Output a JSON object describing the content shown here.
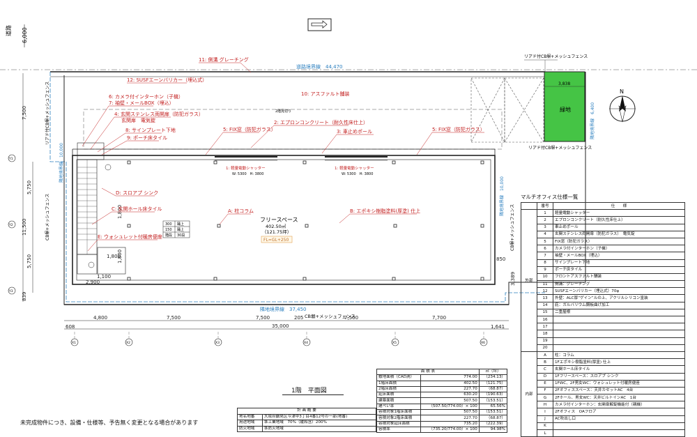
{
  "site": {
    "road_vertical": "道路",
    "road_width": "6,000",
    "road_boundary": "道路境界線　44,470",
    "site_boundary_bottom": "隣地境界線　37,450",
    "site_boundary_left": "隣地境界線　10,000",
    "site_boundary_right_top": "隣地境界線　6,400",
    "site_boundary_right_mid": "隣地境界線　10,000",
    "fence_top_right": "リアド付CB塀+メッシュフェンス",
    "fence_mid_right": "リアド付CB塀+メッシュフェンス",
    "fence_bottom": "CB塀+メッシュフェンス",
    "fence_left_top": "リアド付CB塀+メッシュフェンス",
    "fence_left_mid": "CB塀+メッシュフェンス",
    "fence_right": "CB塀+メッシュフェンス",
    "green_label": "緑地",
    "green_width": "3,838",
    "north": "N"
  },
  "labels": {
    "l11": "11: 側溝 グレーチング",
    "l12": "12: SUSFエーンバリカー（埋込式）",
    "l10": "10: アスファルト舗装",
    "l6": "6: カメラ付インターホン（子機）",
    "l7": "7: 袖壁・メールBOX（埋込）",
    "l4": "4: 玄関ステンレス両開扉（防犯ガラス）",
    "l4b": "玄関扉　電気錠",
    "l8": "8: サインプレート下地",
    "l9": "9: ポーチ床タイル",
    "l5a": "5: FIX窓（防犯ガラス）",
    "l2": "2: エプロンコンクリート（耐久性床仕上）",
    "l3": "3: 車止めポール",
    "l5b": "5: FIX窓（防犯ガラス）",
    "lD": "D: スロアプ シンク",
    "lC": "C: 玄関ホール床タイル",
    "lE": "E: ウォシュレット付暖房便座",
    "lA": "A: 柱コラム",
    "lB": "B: エポキシ樹脂塗料(厚塗) 仕上",
    "shutter1": "1: 軽量電動シャッター",
    "shutter1_size": "W: 5300　H: 3800",
    "shutter2": "1: 軽量電動シャッター",
    "shutter2_size": "W: 5300　H: 3800",
    "rain_gutter": "2階見切り"
  },
  "room": {
    "name": "フリースペース",
    "area_m2": "402.50㎡",
    "area_tsubo": "（121.75坪）",
    "fl": "FL=GL+250"
  },
  "steps": [
    {
      "h": "300",
      "name": "踊上"
    },
    {
      "h": "150",
      "name": "踊上"
    },
    {
      "h": "階段",
      "name": "30段"
    }
  ],
  "dims": {
    "top_left": "7,500",
    "left_a": "5,750",
    "left_b": "11,500",
    "left_c": "5,750",
    "left_d": "839",
    "right_a": "850",
    "right_b": "3,389",
    "bottom_total": "35,000",
    "bottom_left": "608",
    "bottom_right": "1,641",
    "bottom_mid": "205",
    "spans": [
      "4,800",
      "7,500",
      "7,500",
      "7,500",
      "7,700"
    ],
    "inner_1": "2,900",
    "inner_2": "1,100",
    "inner_3": "1,800",
    "inner_4": "1,800",
    "inner_5": "1,800"
  },
  "axes": [
    "X1",
    "X2",
    "X3",
    "X4",
    "X5",
    "X6"
  ],
  "axes_y": [
    "Y1",
    "Y2",
    "Y3"
  ],
  "spec_table": {
    "title": "マルチオフィス仕様一覧",
    "header_no": "番号",
    "header_spec": "仕　　様",
    "exterior_group": "外部",
    "interior_group": "内部",
    "exterior": [
      {
        "no": "1",
        "text": "軽量電動シャッター"
      },
      {
        "no": "2",
        "text": "エプロンコンクリート（耐久性床仕上）"
      },
      {
        "no": "3",
        "text": "車止めポール"
      },
      {
        "no": "4",
        "text": "玄関ステンレス両開扉（防犯ガラス）　電気錠"
      },
      {
        "no": "5",
        "text": "FIX窓（防犯ガラス）"
      },
      {
        "no": "6",
        "text": "カメラ付インターホン（子機）"
      },
      {
        "no": "7",
        "text": "袖壁・メールBOX（埋込）"
      },
      {
        "no": "8",
        "text": "サインプレート下地"
      },
      {
        "no": "9",
        "text": "ポーチ床タイル"
      },
      {
        "no": "10",
        "text": "フロントアスファルト舗装"
      },
      {
        "no": "11",
        "text": "側溝：グレーチング"
      },
      {
        "no": "12",
        "text": "SUSFエーンバリカー（埋込式）70φ"
      },
      {
        "no": "13",
        "text": "外壁：ALC厚”ゲイン”ルの上、アクリルシリコン塗装"
      },
      {
        "no": "14",
        "text": "庇：ガルバリウム鋼板曲げ加工"
      },
      {
        "no": "15",
        "text": "二重屋根"
      },
      {
        "no": "16",
        "text": ""
      },
      {
        "no": "17",
        "text": ""
      },
      {
        "no": "18",
        "text": ""
      },
      {
        "no": "19",
        "text": ""
      },
      {
        "no": "20",
        "text": ""
      }
    ],
    "interior": [
      {
        "no": "A",
        "text": "柱：コラム"
      },
      {
        "no": "B",
        "text": "1Fエポキシ樹脂塗料(厚塗) 仕上"
      },
      {
        "no": "C",
        "text": "玄関ホール床タイル"
      },
      {
        "no": "D",
        "text": "1Fフリースペース：スロアプ シンク"
      },
      {
        "no": "E",
        "text": "1FWC、2F男女WC：ウォシュレット付暖房便座"
      },
      {
        "no": "F",
        "text": "2Fオフィススペース：天井カセットAC　4台"
      },
      {
        "no": "G",
        "text": "2Fホール、男女WC：天井ビルトインAC　1台"
      },
      {
        "no": "H",
        "text": "カメラ付インターホン：玄関扉解錠機能付（親機）"
      },
      {
        "no": "I",
        "text": "2Fオフィス　OAフロア"
      },
      {
        "no": "J",
        "text": "AC吹出し口"
      },
      {
        "no": "K",
        "text": ""
      },
      {
        "no": "L",
        "text": ""
      }
    ]
  },
  "area_table": {
    "title": "面 積 表",
    "unit": "㎡（坪）",
    "rows": [
      {
        "k": "敷地面積（CAD測）",
        "v": "774.00",
        "t": "（234.13）"
      },
      {
        "k": "1階床面積",
        "v": "402.50",
        "t": "（121.75）"
      },
      {
        "k": "2階床面積",
        "v": "227.70",
        "t": "（68.87）"
      },
      {
        "k": "延床面積",
        "v": "630.20",
        "t": "（190.63）"
      },
      {
        "k": "建築面積",
        "v": "507.50",
        "t": "（153.51）"
      },
      {
        "k": "建ぺい率",
        "v": "（507.50/774.00）× 100",
        "t": "65.56%"
      },
      {
        "k": "容積対象1階床面積",
        "v": "507.50",
        "t": "（153.51）"
      },
      {
        "k": "容積対象2階床面積",
        "v": "227.70",
        "t": "（68.87）"
      },
      {
        "k": "容積対象延床面積",
        "v": "735.20",
        "t": "（222.39）"
      },
      {
        "k": "容積率",
        "v": "（735.20/774.00）× 100",
        "t": "94.98%"
      }
    ]
  },
  "plan_table": {
    "title": "計 画 概 要",
    "rows": [
      {
        "k": "地名地番",
        "v": "大阪府鶴見区今津中3丁目4番12号の一部(地番)"
      },
      {
        "k": "用途地域",
        "v": "準工業地域　70%（緩和含）200%"
      },
      {
        "k": "防火地域",
        "v": "準防火地域"
      }
    ]
  },
  "drawing_title": "1階　平面図",
  "note": "未完成物件につき、設備・仕様等、予告無く変更となる場合があります"
}
